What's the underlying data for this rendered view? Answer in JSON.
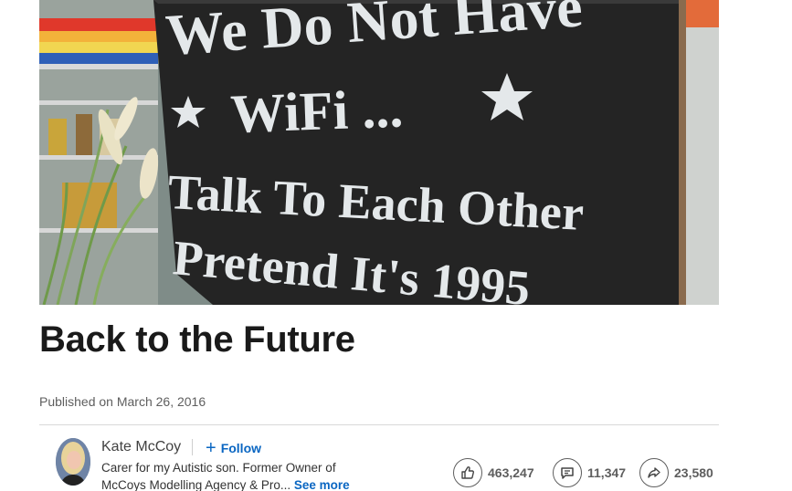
{
  "hero": {
    "sign_lines": [
      "We Do Not Have",
      "WiFi ...",
      "Talk To Each Other",
      "Pretend It's 1995"
    ]
  },
  "article": {
    "title": "Back to the Future",
    "published": "Published on March 26, 2016"
  },
  "author": {
    "name": "Kate McCoy",
    "follow_label": "Follow",
    "bio": "Carer for my Autistic son. Former Owner of McCoys Modelling Agency & Pro...",
    "see_more": "See more"
  },
  "social": {
    "likes": "463,247",
    "comments": "11,347",
    "shares": "23,580"
  },
  "colors": {
    "link": "#0a66c2",
    "sign_board": "#262626",
    "chalk": "#e4e8ea"
  },
  "icons": [
    "plus-icon",
    "thumbs-up-icon",
    "comment-icon",
    "share-icon"
  ]
}
